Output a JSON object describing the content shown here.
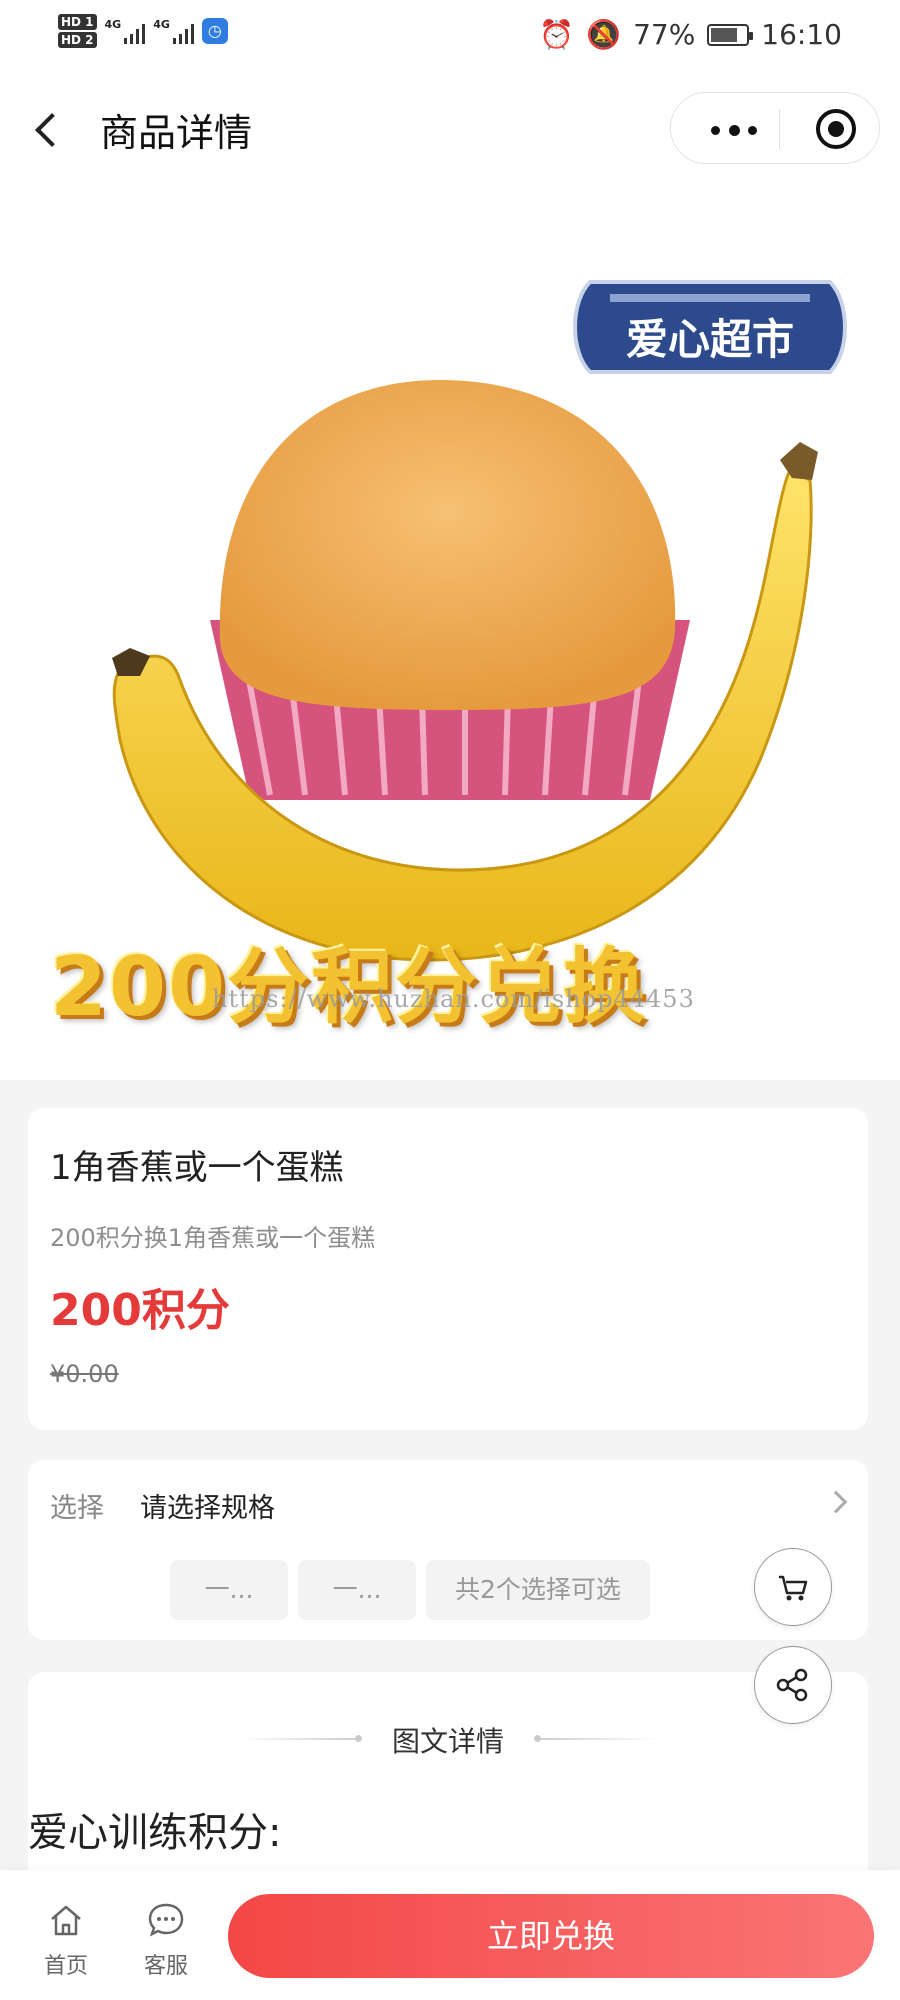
{
  "status_bar": {
    "sim1": "HD 1",
    "sim2": "HD 2",
    "net1": "4G",
    "net2": "4G",
    "battery": "77%",
    "time": "16:10"
  },
  "nav": {
    "title": "商品详情"
  },
  "hero": {
    "shop_sign": "爱心超市",
    "overlay_text": "200分积分兑换",
    "watermark": "https://www.huzhan.com/ishop44453"
  },
  "product": {
    "name": "1角香蕉或一个蛋糕",
    "description": "200积分换1角香蕉或一个蛋糕",
    "points": "200积分",
    "original_price": "¥0.00"
  },
  "spec": {
    "label": "选择",
    "value": "请选择规格",
    "chips": [
      "一...",
      "一...",
      "共2个选择可选"
    ]
  },
  "detail": {
    "section_title": "图文详情",
    "body_text": "爱心训练积分:"
  },
  "bottom": {
    "home_label": "首页",
    "service_label": "客服",
    "buy_label": "立即兑换"
  },
  "colors": {
    "accent": "#e53a3a",
    "button_start": "#f34747",
    "button_end": "#fb7575"
  }
}
